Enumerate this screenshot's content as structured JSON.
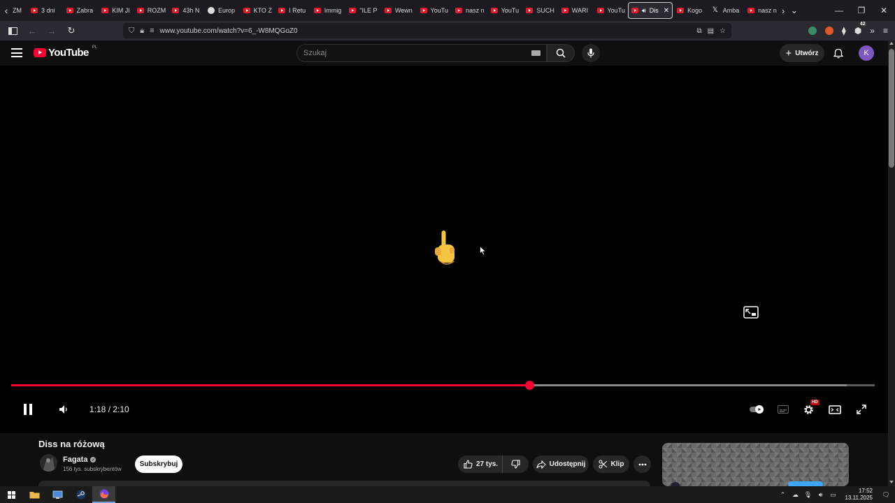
{
  "browser": {
    "tabs": [
      {
        "label": "3 dni",
        "icon": "youtube-favicon"
      },
      {
        "label": "Zabra",
        "icon": "youtube-favicon"
      },
      {
        "label": "KIM JI",
        "icon": "youtube-favicon"
      },
      {
        "label": "ROZM",
        "icon": "youtube-favicon"
      },
      {
        "label": "43h N",
        "icon": "youtube-favicon"
      },
      {
        "label": "Europ",
        "icon": "site-favicon"
      },
      {
        "label": "KTO Z",
        "icon": "youtube-favicon"
      },
      {
        "label": "I Retu",
        "icon": "youtube-favicon"
      },
      {
        "label": "Immig",
        "icon": "youtube-favicon"
      },
      {
        "label": "\"ILE P",
        "icon": "youtube-favicon"
      },
      {
        "label": "Wewn",
        "icon": "youtube-favicon"
      },
      {
        "label": "YouTu",
        "icon": "youtube-favicon"
      },
      {
        "label": "nasz n",
        "icon": "youtube-favicon"
      },
      {
        "label": "YouTu",
        "icon": "youtube-favicon"
      },
      {
        "label": "SUCH",
        "icon": "youtube-favicon"
      },
      {
        "label": "WARI",
        "icon": "youtube-favicon"
      },
      {
        "label": "YouTu",
        "icon": "youtube-favicon"
      },
      {
        "label": "Dis",
        "icon": "youtube-favicon",
        "active": true
      },
      {
        "label": "Kogo",
        "icon": "youtube-favicon"
      },
      {
        "label": "Amba",
        "icon": "x-favicon"
      },
      {
        "label": "nasz n",
        "icon": "youtube-favicon"
      }
    ],
    "first_tab_partial": "ZM",
    "url": "www.youtube.com/watch?v=6_-W8MQGoZ0",
    "extension_badge": "42"
  },
  "youtube": {
    "logo_text": "YouTube",
    "country_code": "PL",
    "search_placeholder": "Szukaj",
    "create_label": "Utwórz",
    "avatar_letter": "K"
  },
  "player": {
    "current_time": "1:18",
    "duration": "2:10",
    "time_display": "1:18 / 2:10",
    "progress_fraction": 0.6,
    "buffered_fraction": 0.968,
    "quality_badge": "HD",
    "state": "playing"
  },
  "video": {
    "title": "Diss na różową",
    "channel": "Fagata",
    "subscribers": "156 tys. subskrybentów",
    "subscribe_label": "Subskrybuj",
    "likes": "27 tys.",
    "share_label": "Udostępnij",
    "clip_label": "Klip"
  },
  "taskbar": {
    "time": "17:52",
    "date": "13.11.2025"
  },
  "colors": {
    "youtube_red": "#ff0033",
    "page_bg": "#0f0f0f",
    "browser_chrome": "#2b2a33",
    "avatar_purple": "#7e57c2"
  }
}
